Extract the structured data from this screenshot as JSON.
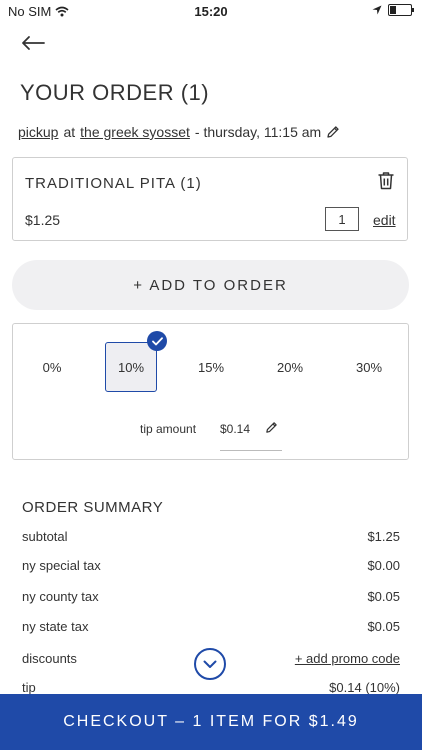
{
  "status_bar": {
    "carrier": "No SIM",
    "time": "15:20"
  },
  "page_title": "YOUR ORDER (1)",
  "order_meta": {
    "mode": "pickup",
    "at": "at",
    "location": "the greek syosset",
    "when": "- thursday, 11:15 am"
  },
  "item": {
    "title": "TRADITIONAL PITA (1)",
    "price": "$1.25",
    "quantity": "1",
    "edit_label": "edit"
  },
  "add_to_order_label": "+ ADD TO ORDER",
  "tip": {
    "options": [
      "0%",
      "10%",
      "15%",
      "20%",
      "30%"
    ],
    "selected": "10%",
    "amount_label": "tip amount",
    "amount": "$0.14"
  },
  "summary": {
    "title": "ORDER SUMMARY",
    "rows": [
      {
        "label": "subtotal",
        "value": "$1.25"
      },
      {
        "label": "ny special tax",
        "value": "$0.00"
      },
      {
        "label": "ny county tax",
        "value": "$0.05"
      },
      {
        "label": "ny state tax",
        "value": "$0.05"
      },
      {
        "label": "discounts",
        "value": "+ add promo code"
      },
      {
        "label": "tip",
        "value": "$0.14 (10%)"
      }
    ]
  },
  "checkout_label": "CHECKOUT – 1 ITEM FOR $1.49",
  "colors": {
    "accent": "#1f4aa8",
    "button_bg": "#f0f0f2",
    "border": "#cfcfcf"
  },
  "icons": [
    "wifi-icon",
    "location-arrow-icon",
    "battery-icon",
    "back-arrow-icon",
    "pencil-icon",
    "trash-icon",
    "check-icon",
    "chevron-down-icon"
  ]
}
